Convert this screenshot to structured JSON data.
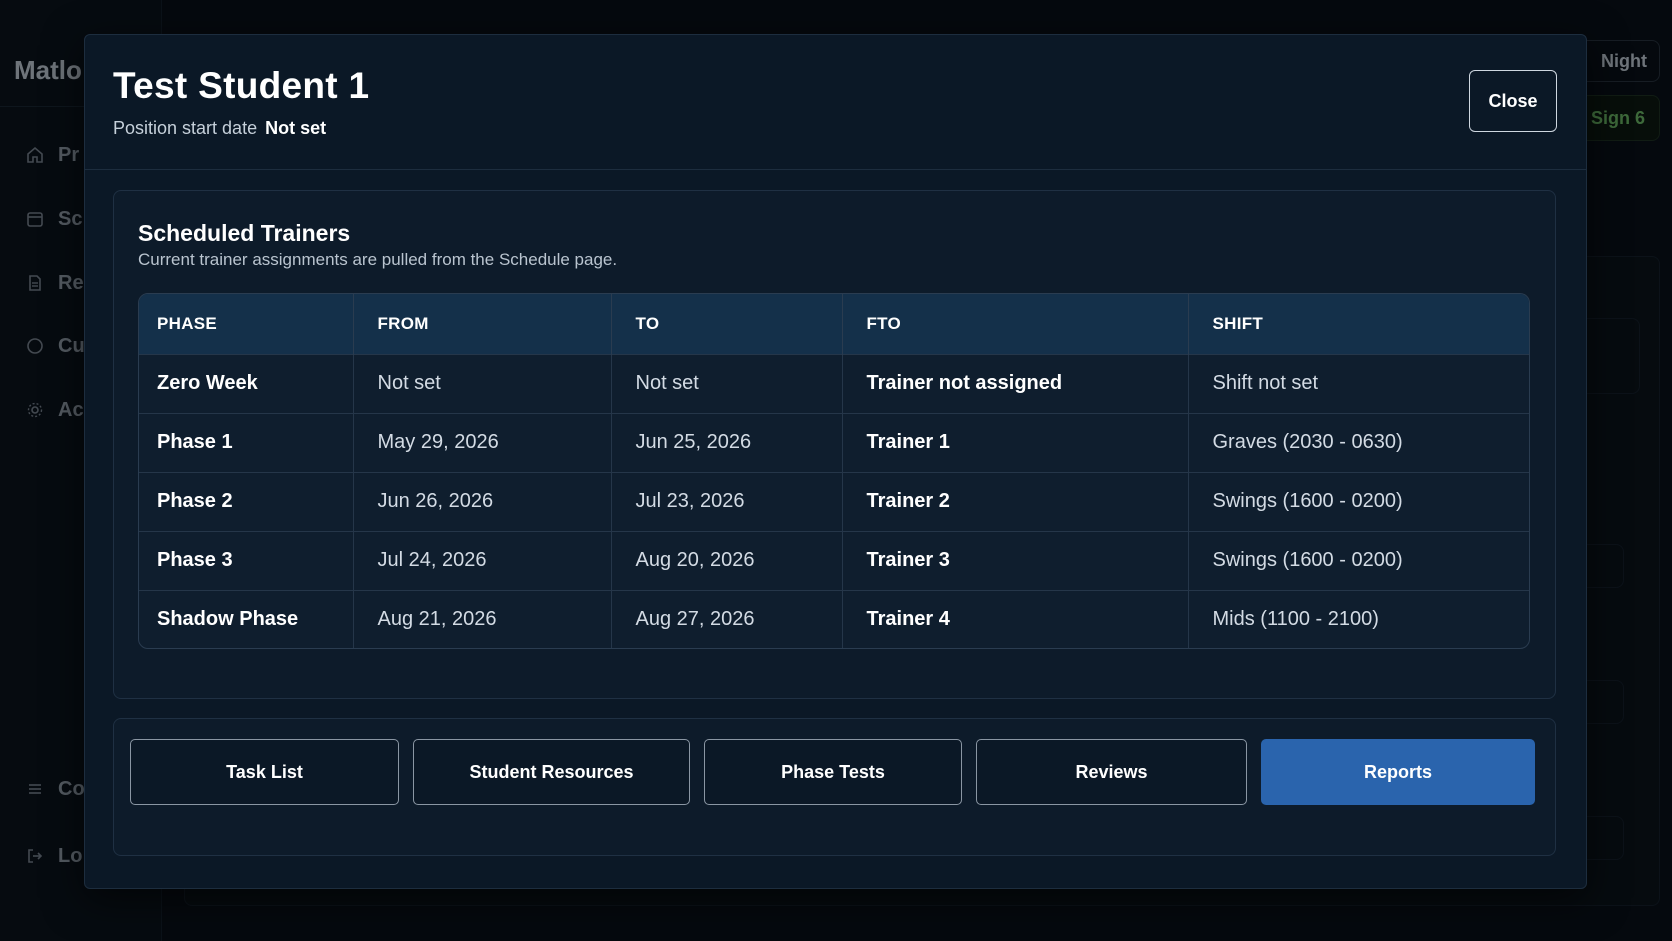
{
  "background": {
    "app_name": "Matlo",
    "nav_items": [
      {
        "label": "Pr",
        "icon": "home-icon"
      },
      {
        "label": "Sc",
        "icon": "calendar-icon"
      },
      {
        "label": "Re",
        "icon": "document-icon"
      },
      {
        "label": "Cu",
        "icon": "shield-icon"
      },
      {
        "label": "Ac",
        "icon": "gear-icon"
      }
    ],
    "bottom_items": [
      {
        "label": "Co",
        "icon": "menu-icon"
      },
      {
        "label": "Lo",
        "icon": "logout-icon"
      }
    ],
    "top_right_label": "Night",
    "sign_label": "Sign 6"
  },
  "modal": {
    "student_name": "Test Student 1",
    "start_date_label": "Position start date",
    "start_date_value": "Not set",
    "close_label": "Close",
    "trainers": {
      "title": "Scheduled Trainers",
      "subtitle": "Current trainer assignments are pulled from the Schedule page.",
      "columns": [
        "PHASE",
        "FROM",
        "TO",
        "FTO",
        "SHIFT"
      ],
      "rows": [
        {
          "phase": "Zero Week",
          "from": "Not set",
          "to": "Not set",
          "fto": "Trainer not assigned",
          "shift": "Shift not set"
        },
        {
          "phase": "Phase 1",
          "from": "May 29, 2026",
          "to": "Jun 25, 2026",
          "fto": "Trainer 1",
          "shift": "Graves (2030 - 0630)"
        },
        {
          "phase": "Phase 2",
          "from": "Jun 26, 2026",
          "to": "Jul 23, 2026",
          "fto": "Trainer 2",
          "shift": "Swings (1600 - 0200)"
        },
        {
          "phase": "Phase 3",
          "from": "Jul 24, 2026",
          "to": "Aug 20, 2026",
          "fto": "Trainer 3",
          "shift": "Swings (1600 - 0200)"
        },
        {
          "phase": "Shadow Phase",
          "from": "Aug 21, 2026",
          "to": "Aug 27, 2026",
          "fto": "Trainer 4",
          "shift": "Mids (1100 - 2100)"
        }
      ]
    },
    "actions": {
      "task_list": "Task List",
      "student_resources": "Student Resources",
      "phase_tests": "Phase Tests",
      "reviews": "Reviews",
      "reports": "Reports"
    }
  },
  "colors": {
    "accent": "#2a64ad",
    "header_bg": "#14304a",
    "modal_bg": "#0b1826",
    "success": "#6fbf6a"
  }
}
